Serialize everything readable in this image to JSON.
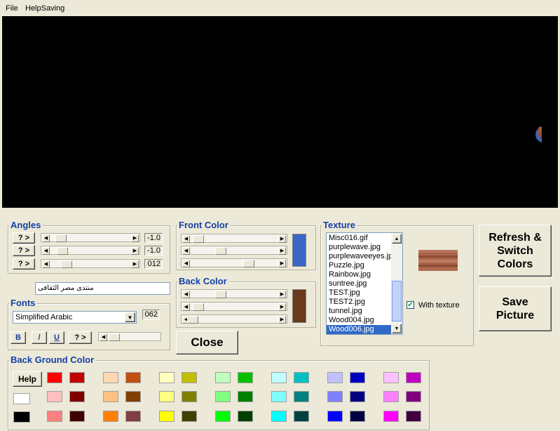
{
  "menu": {
    "file": "File",
    "help_saving": "HelpSaving"
  },
  "banner_text": "منتدى مصر الثقافى",
  "angles": {
    "title": "Angles",
    "button_label": "? >",
    "values": [
      "-1.0",
      "-1.0",
      "012"
    ]
  },
  "text_input": {
    "value": "منتدى مصر الثقافى"
  },
  "fonts": {
    "title": "Fonts",
    "selected": "Simplified Arabic",
    "size": "062",
    "bold": "B",
    "italic": "/",
    "underline": "U",
    "more": "? >"
  },
  "front_color": {
    "title": "Front Color",
    "swatch": "#3a66c8"
  },
  "back_color": {
    "title": "Back Color",
    "swatch": "#6b3a1c"
  },
  "texture": {
    "title": "Texture",
    "items": [
      "Misc016.gif",
      "purplewave.jpg",
      "purplewaveeyes.jpg",
      "Puzzle.jpg",
      "Rainbow.jpg",
      "suntree.jpg",
      "TEST.jpg",
      "TEST2.jpg",
      "tunnel.jpg",
      "Wood004.jpg",
      "Wood006.jpg"
    ],
    "selected_index": 10,
    "with_texture_label": "With texture",
    "with_texture_checked": true
  },
  "buttons": {
    "refresh": "Refresh & Switch Colors",
    "save": "Save Picture",
    "close": "Close",
    "help": "Help"
  },
  "background_color": {
    "title": "Back Ground Color",
    "palette": [
      [
        "#ff0000",
        "#c00000",
        "#ffd8b0",
        "#c05010",
        "#ffffc0",
        "#c0c000",
        "#c0ffc0",
        "#00c000",
        "#c0ffff",
        "#00c0c0",
        "#c0c0ff",
        "#0000c0",
        "#ffc0ff",
        "#c000c0"
      ],
      [
        "#ffc0c0",
        "#800000",
        "#ffc080",
        "#804000",
        "#ffff80",
        "#808000",
        "#80ff80",
        "#008000",
        "#80ffff",
        "#008080",
        "#8080ff",
        "#000080",
        "#ff80ff",
        "#800080"
      ],
      [
        "#ff8080",
        "#400000",
        "#ff8000",
        "#804040",
        "#ffff00",
        "#404000",
        "#00ff00",
        "#004000",
        "#00ffff",
        "#004040",
        "#0000ff",
        "#000040",
        "#ff00ff",
        "#400040"
      ]
    ],
    "side_swatches": [
      "#ffffff",
      "#000000"
    ]
  }
}
